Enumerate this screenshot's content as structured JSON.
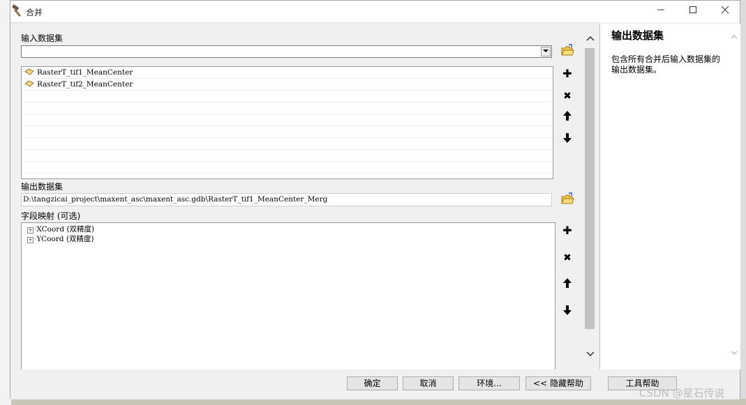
{
  "window": {
    "title": "合并",
    "controls": [
      "minimize-icon",
      "maximize-icon",
      "close-icon"
    ]
  },
  "input_datasets": {
    "label": "输入数据集",
    "combo_value": "",
    "items": [
      {
        "label": "RasterT_tif1_MeanCenter",
        "icon": "feature-class-icon"
      },
      {
        "label": "RasterT_tif2_MeanCenter",
        "icon": "feature-class-icon"
      }
    ]
  },
  "output_dataset": {
    "label": "输出数据集",
    "value": "D:\\tangzicai_project\\maxent_asc\\maxent_asc.gdb\\RasterT_tif1_MeanCenter_Merg"
  },
  "field_map": {
    "label": "字段映射 (可选)",
    "fields": [
      {
        "name": "XCoord",
        "type": "(双精度)"
      },
      {
        "name": "YCoord",
        "type": "(双精度)"
      }
    ]
  },
  "side_buttons": {
    "add": "✚",
    "remove": "✖",
    "up": "🡅",
    "down": "🡇"
  },
  "help": {
    "title": "输出数据集",
    "text": "包含所有合并后输入数据集的输出数据集。"
  },
  "buttons": {
    "ok": "确定",
    "cancel": "取消",
    "environments": "环境...",
    "hide_help": "<< 隐藏帮助",
    "tool_help": "工具帮助"
  },
  "watermark": "CSDN @星石传说"
}
